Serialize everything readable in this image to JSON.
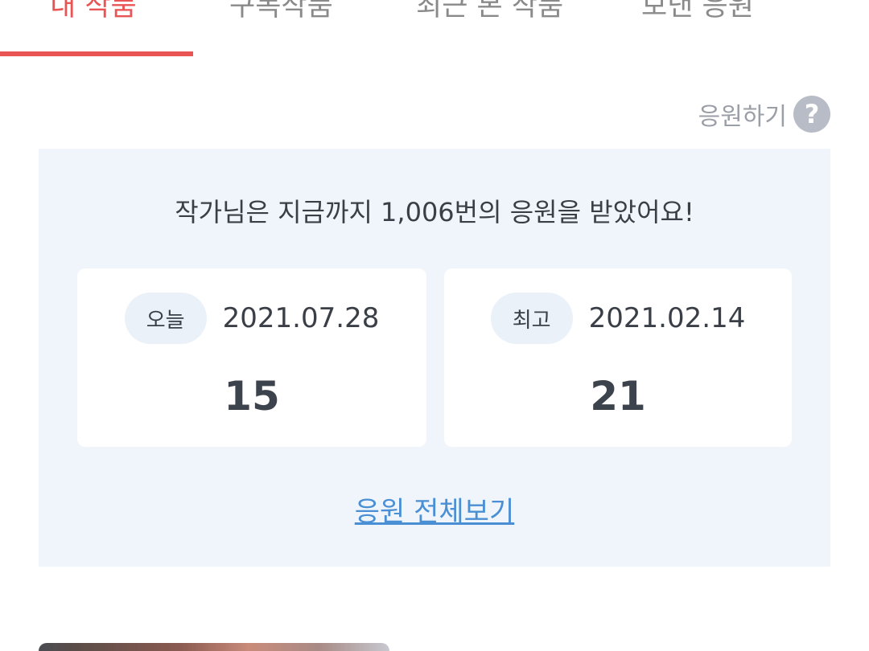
{
  "tabs": [
    {
      "label": "내 작품",
      "active": true
    },
    {
      "label": "구독작품",
      "active": false
    },
    {
      "label": "최근 본 작품",
      "active": false
    },
    {
      "label": "보낸 응원",
      "active": false
    }
  ],
  "help": {
    "label": "응원하기",
    "icon": "question-circle-icon",
    "glyph": "?"
  },
  "summary": "작가님은 지금까지 1,006번의 응원을 받았어요!",
  "stats": {
    "today": {
      "badge": "오늘",
      "date": "2021.07.28",
      "count": "15"
    },
    "best": {
      "badge": "최고",
      "date": "2021.02.14",
      "count": "21"
    }
  },
  "view_all": "응원 전체보기",
  "colors": {
    "accent": "#e95454",
    "panel_bg": "#eff5fb",
    "link": "#4a8fd4",
    "text": "#3a3f47"
  }
}
